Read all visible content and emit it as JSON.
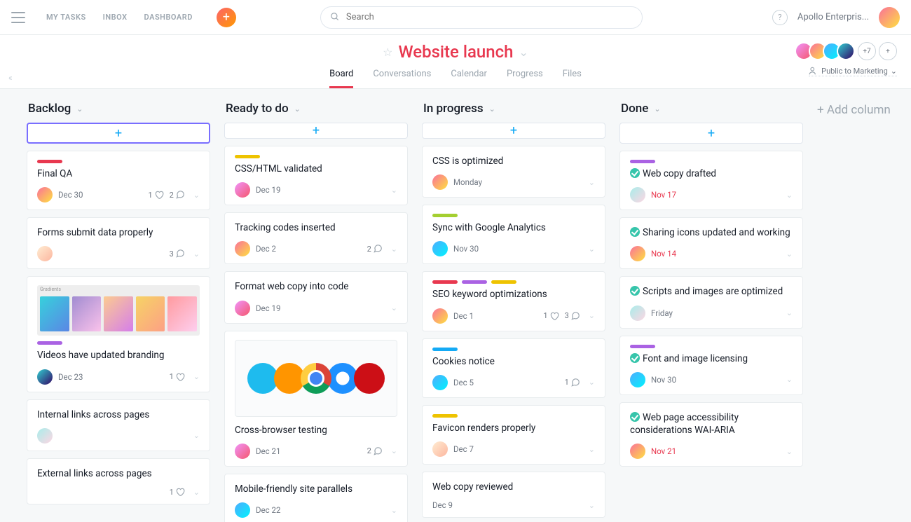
{
  "topnav": {
    "my_tasks": "MY TASKS",
    "inbox": "INBOX",
    "dashboard": "DASHBOARD"
  },
  "search": {
    "placeholder": "Search"
  },
  "org": {
    "name": "Apollo Enterpris..."
  },
  "project": {
    "title": "Website launch",
    "tabs": [
      "Board",
      "Conversations",
      "Calendar",
      "Progress",
      "Files"
    ],
    "active_tab": "Board",
    "more_members": "+7",
    "visibility": "Public to Marketing"
  },
  "add_column_label": "+ Add column",
  "columns": [
    {
      "title": "Backlog",
      "add_focused": true,
      "cards": [
        {
          "tags": [
            "red"
          ],
          "title": "Final QA",
          "avatar": "av-c",
          "date": "Dec 30",
          "likes": 1,
          "comments": 2
        },
        {
          "title": "Forms submit data properly",
          "avatar": "av-f",
          "comments": 3
        },
        {
          "image": "gradients",
          "tags": [
            "purple"
          ],
          "title": "Videos have updated branding",
          "avatar": "av-d",
          "date": "Dec 23",
          "likes": 1
        },
        {
          "title": "Internal links across pages",
          "avatar": "av-e"
        },
        {
          "title": "External links across pages",
          "likes": 1
        }
      ]
    },
    {
      "title": "Ready to do",
      "cards": [
        {
          "tags": [
            "yellow"
          ],
          "title": "CSS/HTML validated",
          "avatar": "av-a",
          "date": "Dec 19"
        },
        {
          "title": "Tracking codes inserted",
          "avatar": "av-c",
          "date": "Dec 2",
          "comments": 2
        },
        {
          "title": "Format web copy into code",
          "avatar": "av-a",
          "date": "Dec 19"
        },
        {
          "image": "browsers",
          "title": "Cross-browser testing",
          "avatar": "av-a",
          "date": "Dec 21",
          "comments": 2
        },
        {
          "title": "Mobile-friendly site parallels",
          "avatar": "av-b",
          "date": "Dec 22"
        }
      ]
    },
    {
      "title": "In progress",
      "cards": [
        {
          "title": "CSS is optimized",
          "avatar": "av-c",
          "date": "Monday"
        },
        {
          "tags": [
            "green"
          ],
          "title": "Sync with Google Analytics",
          "avatar": "av-b",
          "date": "Nov 30"
        },
        {
          "tags": [
            "red",
            "purple",
            "yellow"
          ],
          "title": "SEO keyword optimizations",
          "avatar": "av-c",
          "date": "Dec 1",
          "likes": 1,
          "comments": 3
        },
        {
          "tags": [
            "blue"
          ],
          "title": "Cookies notice",
          "avatar": "av-b",
          "date": "Dec 5",
          "comments": 1
        },
        {
          "tags": [
            "yellow"
          ],
          "title": "Favicon renders properly",
          "avatar": "av-f",
          "date": "Dec 7"
        },
        {
          "title": "Web copy reviewed",
          "date": "Dec 9"
        }
      ]
    },
    {
      "title": "Done",
      "cards": [
        {
          "tags": [
            "purple"
          ],
          "done": true,
          "title": "Web copy drafted",
          "avatar": "av-e",
          "date": "Nov 17",
          "overdue": true
        },
        {
          "done": true,
          "title": "Sharing icons updated and working",
          "avatar": "av-c",
          "date": "Nov 14",
          "overdue": true
        },
        {
          "done": true,
          "title": "Scripts and images are optimized",
          "avatar": "av-e",
          "date": "Friday"
        },
        {
          "tags": [
            "purple"
          ],
          "done": true,
          "title": "Font and image licensing",
          "avatar": "av-b",
          "date": "Nov 30"
        },
        {
          "done": true,
          "title": "Web page accessibility considerations WAI-ARIA",
          "avatar": "av-c",
          "date": "Nov 21",
          "overdue": true
        }
      ]
    }
  ]
}
